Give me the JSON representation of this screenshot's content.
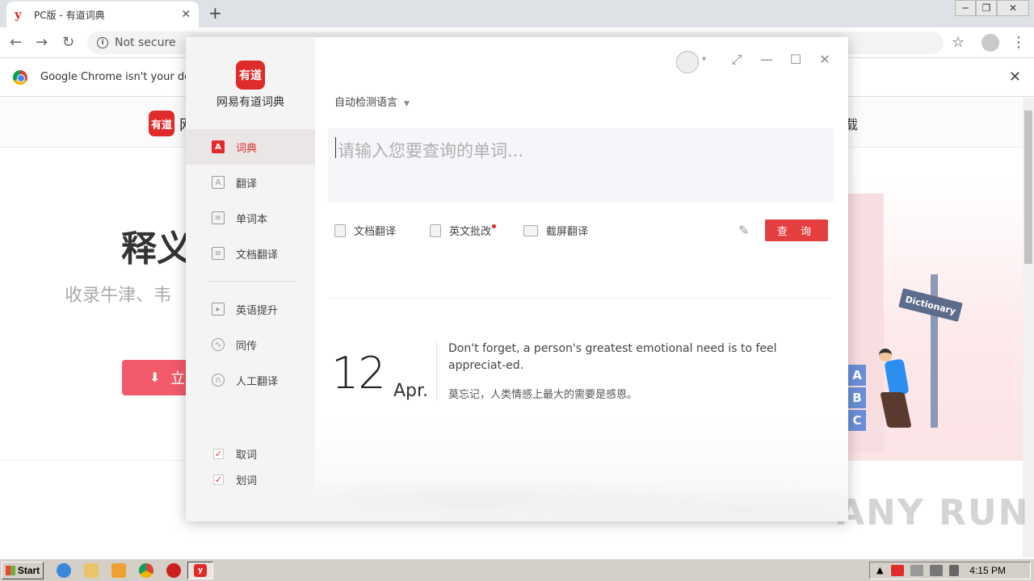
{
  "browser": {
    "tab_title": "PC版 - 有道词典",
    "tab_favicon": "y",
    "address_security": "Not secure",
    "infobar_text": "Google Chrome isn't your default",
    "new_tab_icon": "plus-icon"
  },
  "website": {
    "logo_text": "有道",
    "logo_rest": "网",
    "download_text": "载",
    "headline": "释义",
    "subline": "收录牛津、韦",
    "button_label": "立",
    "illustration_sign": "Dictionary",
    "illustration_blocks": [
      "A",
      "B",
      "C"
    ],
    "watermark": "ANY RUN"
  },
  "taskbar": {
    "start_label": "Start",
    "clock": "4:15 PM"
  },
  "youdao": {
    "logo_text": "有道",
    "app_name": "网易有道词典",
    "nav": [
      {
        "label": "词典",
        "icon": "dictionary-icon"
      },
      {
        "label": "翻译",
        "icon": "translate-icon"
      },
      {
        "label": "单词本",
        "icon": "wordbook-icon"
      },
      {
        "label": "文档翻译",
        "icon": "document-icon"
      },
      {
        "label": "英语提升",
        "icon": "video-icon"
      },
      {
        "label": "同传",
        "icon": "simultaneous-icon"
      },
      {
        "label": "人工翻译",
        "icon": "headset-icon"
      }
    ],
    "checks": [
      {
        "label": "取词",
        "checked": true
      },
      {
        "label": "划词",
        "checked": true
      }
    ],
    "language_select": "自动检测语言",
    "search_placeholder": "请输入您要查询的单词...",
    "tools": [
      {
        "label": "文档翻译",
        "icon": "doc-translate-icon"
      },
      {
        "label": "英文批改",
        "icon": "correction-icon"
      },
      {
        "label": "截屏翻译",
        "icon": "screenshot-icon"
      }
    ],
    "search_button": "查 询",
    "daily": {
      "day": "12",
      "month": "Apr.",
      "quote_en": "Don't forget, a person's greatest emotional need is to feel appreciat-ed.",
      "quote_cn": "莫忘记，人类情感上最大的需要是感恩。"
    }
  }
}
